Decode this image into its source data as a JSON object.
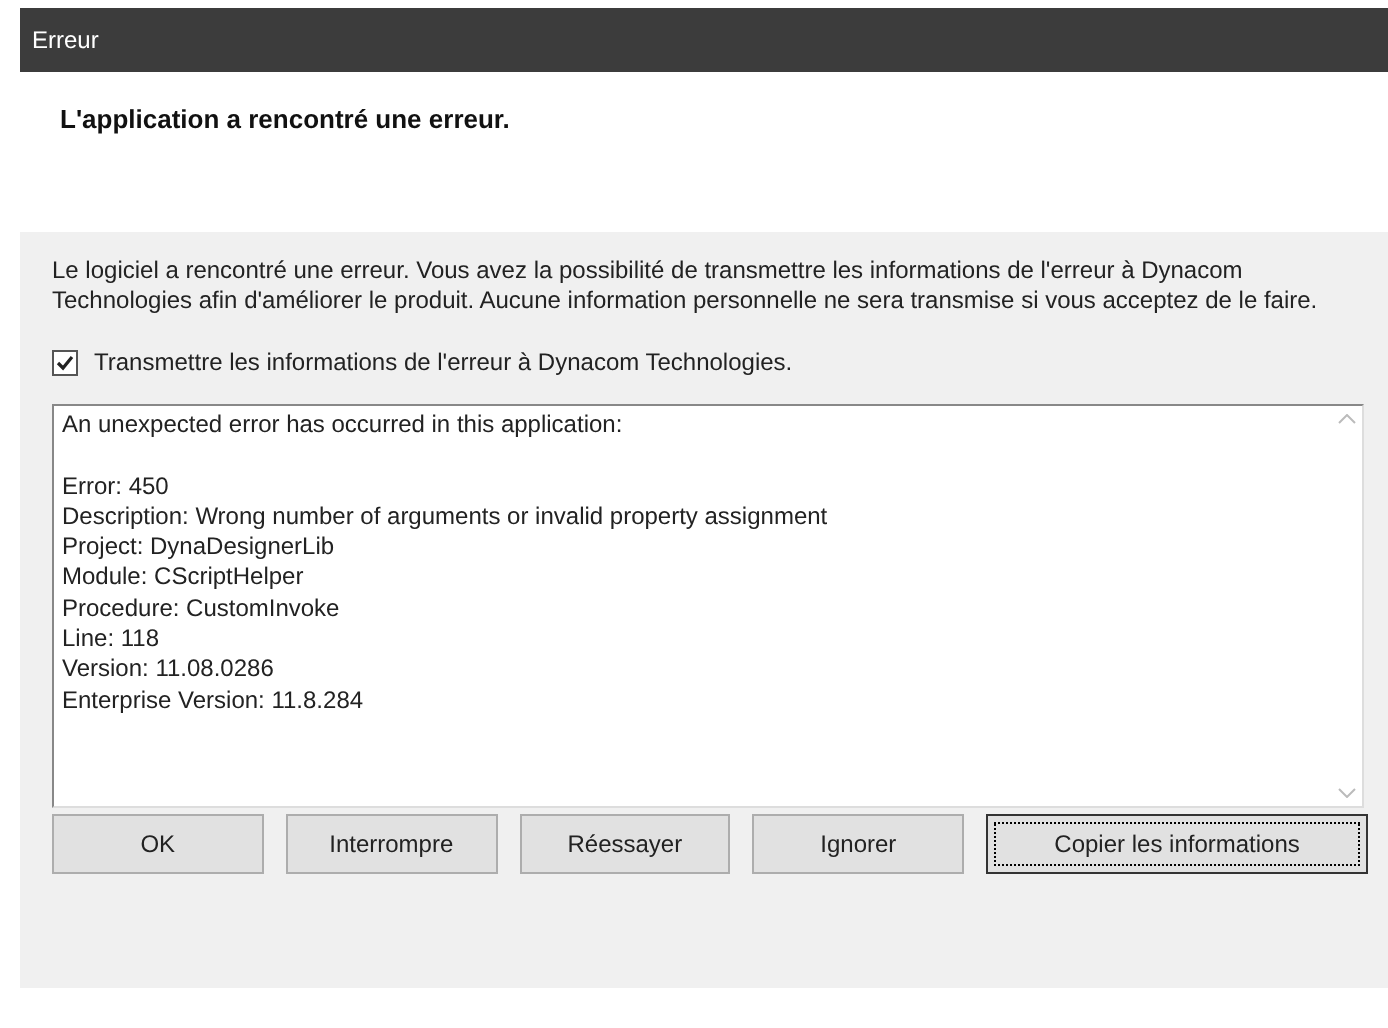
{
  "window": {
    "title": "Erreur"
  },
  "header": {
    "title": "L'application a rencontré une erreur."
  },
  "message": "Le logiciel a rencontré une erreur. Vous avez la possibilité de transmettre les informations de l'erreur à Dynacom Technologies afin d'améliorer le produit. Aucune information personnelle ne sera transmise si vous acceptez de le faire.",
  "send_report": {
    "label": "Transmettre les informations de l'erreur à Dynacom Technologies.",
    "checked": true
  },
  "details": {
    "intro": "An unexpected error has occurred in this application:",
    "lines": [
      "Error: 450",
      "Description: Wrong number of arguments or invalid property assignment",
      "Project: DynaDesignerLib",
      "Module: CScriptHelper",
      "Procedure: CustomInvoke",
      "Line: 118",
      "Version: 11.08.0286",
      "Enterprise Version: 11.8.284"
    ]
  },
  "buttons": [
    {
      "label": "OK",
      "focused": false
    },
    {
      "label": "Interrompre",
      "focused": false
    },
    {
      "label": "Réessayer",
      "focused": false
    },
    {
      "label": "Ignorer",
      "focused": false
    },
    {
      "label": "Copier les informations",
      "focused": true
    }
  ]
}
